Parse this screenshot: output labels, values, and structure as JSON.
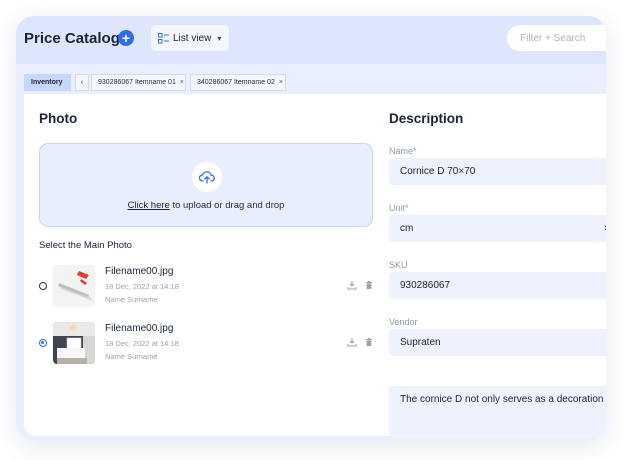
{
  "header": {
    "title": "Price Catalog",
    "add_icon": "plus-circle-icon",
    "view_select": {
      "label": "List view",
      "icon": "list-grid-icon"
    },
    "search": {
      "placeholder": "Filter + Search",
      "value": ""
    }
  },
  "tabs": [
    {
      "label": "Inventory",
      "closable": false,
      "active": true
    },
    {
      "label": "930286067 Itemname 01",
      "closable": true,
      "active": false
    },
    {
      "label": "340286067 Itemname 02",
      "closable": true,
      "active": false
    }
  ],
  "photo": {
    "title": "Photo",
    "upload": {
      "link": "Click here",
      "text": " to upload or drag and drop",
      "icon": "upload-cloud-icon"
    },
    "main_photo_label": "Select the Main Photo",
    "files": [
      {
        "name": "Filename00.jpg",
        "date": "18 Dec, 2022 at 14:18",
        "owner": "Name Surname",
        "selected": false
      },
      {
        "name": "Filename00.jpg",
        "date": "18 Dec, 2022 at 14:18",
        "owner": "Name Surname",
        "selected": true
      }
    ]
  },
  "description": {
    "title": "Description",
    "name": {
      "label": "Name*",
      "value": "Cornice D 70×70"
    },
    "unit": {
      "label": "Unit*",
      "value": "cm"
    },
    "sku": {
      "label": "SKU",
      "value": "930286067"
    },
    "vendor": {
      "label": "Vendor",
      "value": "Supraten"
    },
    "text": "The cornice D not only serves as a decoration"
  },
  "colors": {
    "accent": "#2f6bf0",
    "header_bg": "#dde6fd",
    "field_bg": "#eef2fd",
    "upload_bg": "#e7eefe"
  }
}
